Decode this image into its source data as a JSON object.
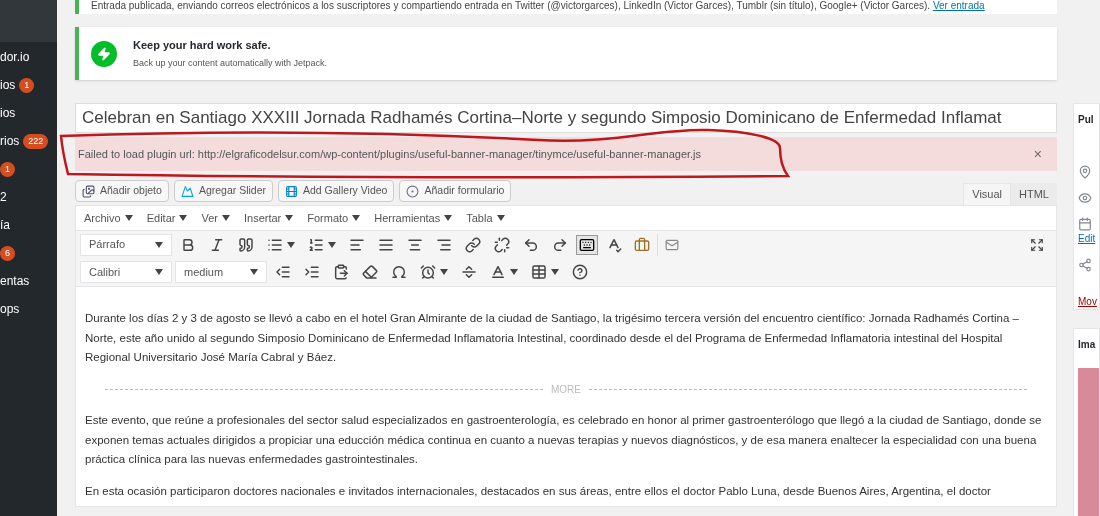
{
  "admin_menu": [
    {
      "label": "dor.io"
    },
    {
      "label": "ios",
      "badge": "1"
    },
    {
      "label": "ios"
    },
    {
      "label": "rios",
      "badge": "222"
    },
    {
      "badge": "1"
    },
    {
      "label": "2"
    },
    {
      "label": "ía"
    },
    {
      "badge": "6"
    },
    {
      "label": "entas"
    },
    {
      "label": "ops"
    }
  ],
  "published_notice": {
    "text": "Entrada publicada, enviando correos electrónicos a los suscriptores y compartiendo entrada en Twitter (@victorgarces), LinkedIn (Victor Garces), Tumblr (sin título), Google+ (Victor Garces).",
    "link": "Ver entrada"
  },
  "jetpack_notice": {
    "title": "Keep your hard work safe.",
    "text": "Back up your content automatically with Jetpack."
  },
  "post_title": "Celebran en Santiago XXXIII Jornada Radhamés Cortina–Norte y segundo Simposio Dominicano de Enfermedad Inflamat",
  "error_notice": {
    "text": "Failed to load plugin url: http://elgraficodelsur.com/wp-content/plugins/useful-banner-manager/tinymce/useful-banner-manager.js",
    "close": "×"
  },
  "media_buttons": [
    {
      "kind": "object",
      "label": "Añadir objeto"
    },
    {
      "kind": "slider",
      "label": "Agregar Slider"
    },
    {
      "kind": "video",
      "label": "Add Gallery Video"
    },
    {
      "kind": "form",
      "label": "Añadir formulario"
    }
  ],
  "editor_tabs": [
    {
      "label": "Visual",
      "selected": true
    },
    {
      "label": "HTML",
      "selected": false
    }
  ],
  "menu_bar": [
    "Archivo",
    "Editar",
    "Ver",
    "Insertar",
    "Formato",
    "Herramientas",
    "Tabla"
  ],
  "format_select": "Párrafo",
  "font_select": "Calibri",
  "size_select": "medium",
  "content": {
    "paragraphs_before": [
      "Durante los días 2 y 3 de agosto se llevó a cabo en el hotel Gran Almirante de la ciudad de Santiago, la trigésimo tercera versión del encuentro científico:  Jornada Radhamés Cortina – Norte, este año unido al segundo Simposio Dominicano de Enfermedad Inflamatoria Intestinal, coordinado desde el del Programa de Enfermedad Inflamatoria intestinal del Hospital Regional Universitario José María Cabral y Báez."
    ],
    "more_label": "MORE",
    "paragraphs_after": [
      "Este evento, que reúne a profesionales del sector salud especializados en gastroenterología, es celebrado en honor al primer gastroenterólogo que llegó a la ciudad de Santiago, donde se exponen temas actuales dirigidos a propiciar una educción médica continua en cuanto a nuevas terapias y nuevos diagnósticos, y de esa manera enaltecer la especialidad con una buena práctica clínica para las nuevas enfermedades gastrointestinales.",
      "En esta ocasión participaron doctores nacionales e invitados internacionales, destacados en sus áreas, entre ellos el doctor Pablo Luna, desde Buenos Aires, Argentina, el doctor"
    ]
  },
  "publish_box": {
    "title": "Pul",
    "edit_link": "Edit",
    "trash_link": "Mov"
  },
  "image_box": {
    "title": "Ima"
  }
}
